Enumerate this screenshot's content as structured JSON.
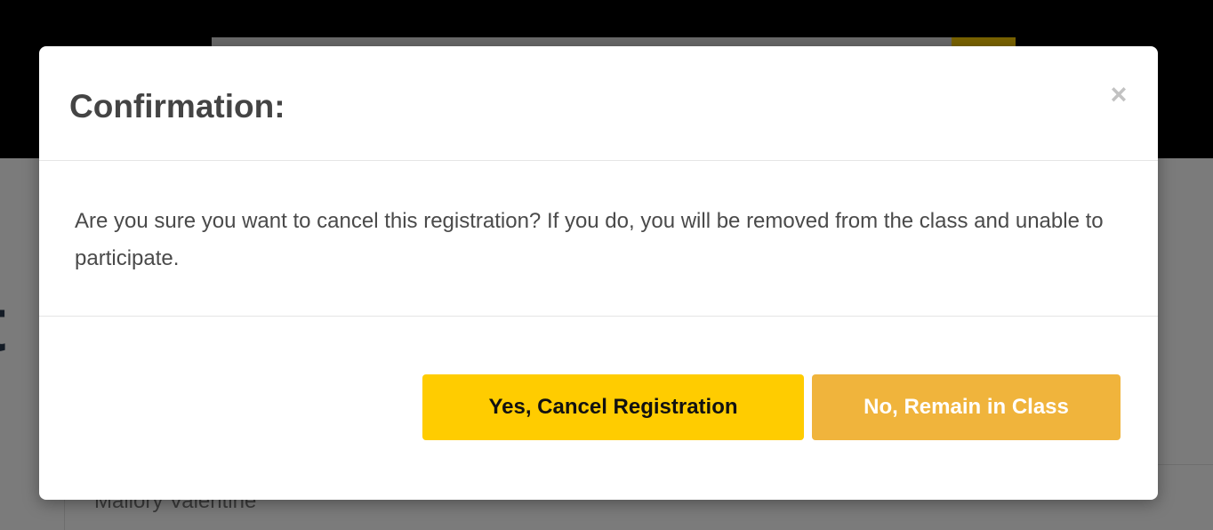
{
  "background": {
    "heading_fragment": "t",
    "panel_name": "Mallory Valentine"
  },
  "modal": {
    "title": "Confirmation:",
    "close_symbol": "×",
    "message": "Are you sure you want to cancel this registration? If you do, you will be removed from the class and unable to participate.",
    "confirm_label": "Yes, Cancel Registration",
    "cancel_label": "No, Remain in Class"
  },
  "colors": {
    "confirm_button": "#ffcc00",
    "cancel_button": "#f0b43c",
    "title_text": "#444444"
  },
  "icons": {
    "close": "close-icon"
  }
}
